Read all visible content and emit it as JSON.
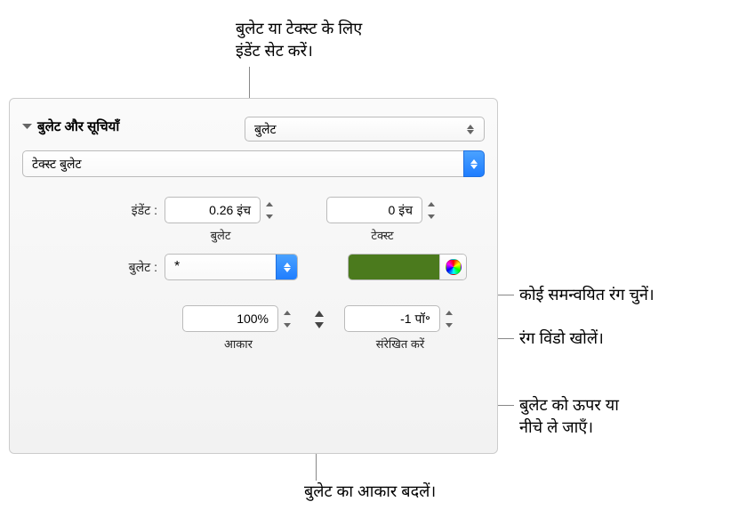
{
  "annotations": {
    "indent_set": "बुलेट या टेक्स्ट के लिए\nइंडेंट सेट करें।",
    "coordinated_color": "कोई समन्वयित रंग चुनें।",
    "open_color_window": "रंग विंडो खोलें।",
    "move_bullet": "बुलेट को ऊपर या\nनीचे ले जाएँ।",
    "change_size": "बुलेट का आकार बदलें।"
  },
  "header": {
    "title": "बुलेट और सूचियाँ"
  },
  "list_type": {
    "value": "बुलेट"
  },
  "bullet_type": {
    "value": "टेक्स्ट बुलेट"
  },
  "indent": {
    "label": "इंडेंट :",
    "bullet_value": "0.26 इंच",
    "bullet_label": "बुलेट",
    "text_value": "0 इंच",
    "text_label": "टेक्स्ट"
  },
  "bullet": {
    "label": "बुलेट :",
    "char": "*",
    "color": "#4b7a1d"
  },
  "size": {
    "value": "100%",
    "label": "आकार"
  },
  "align": {
    "value": "-1 पॉ॰",
    "label": "संरेखित करें"
  }
}
